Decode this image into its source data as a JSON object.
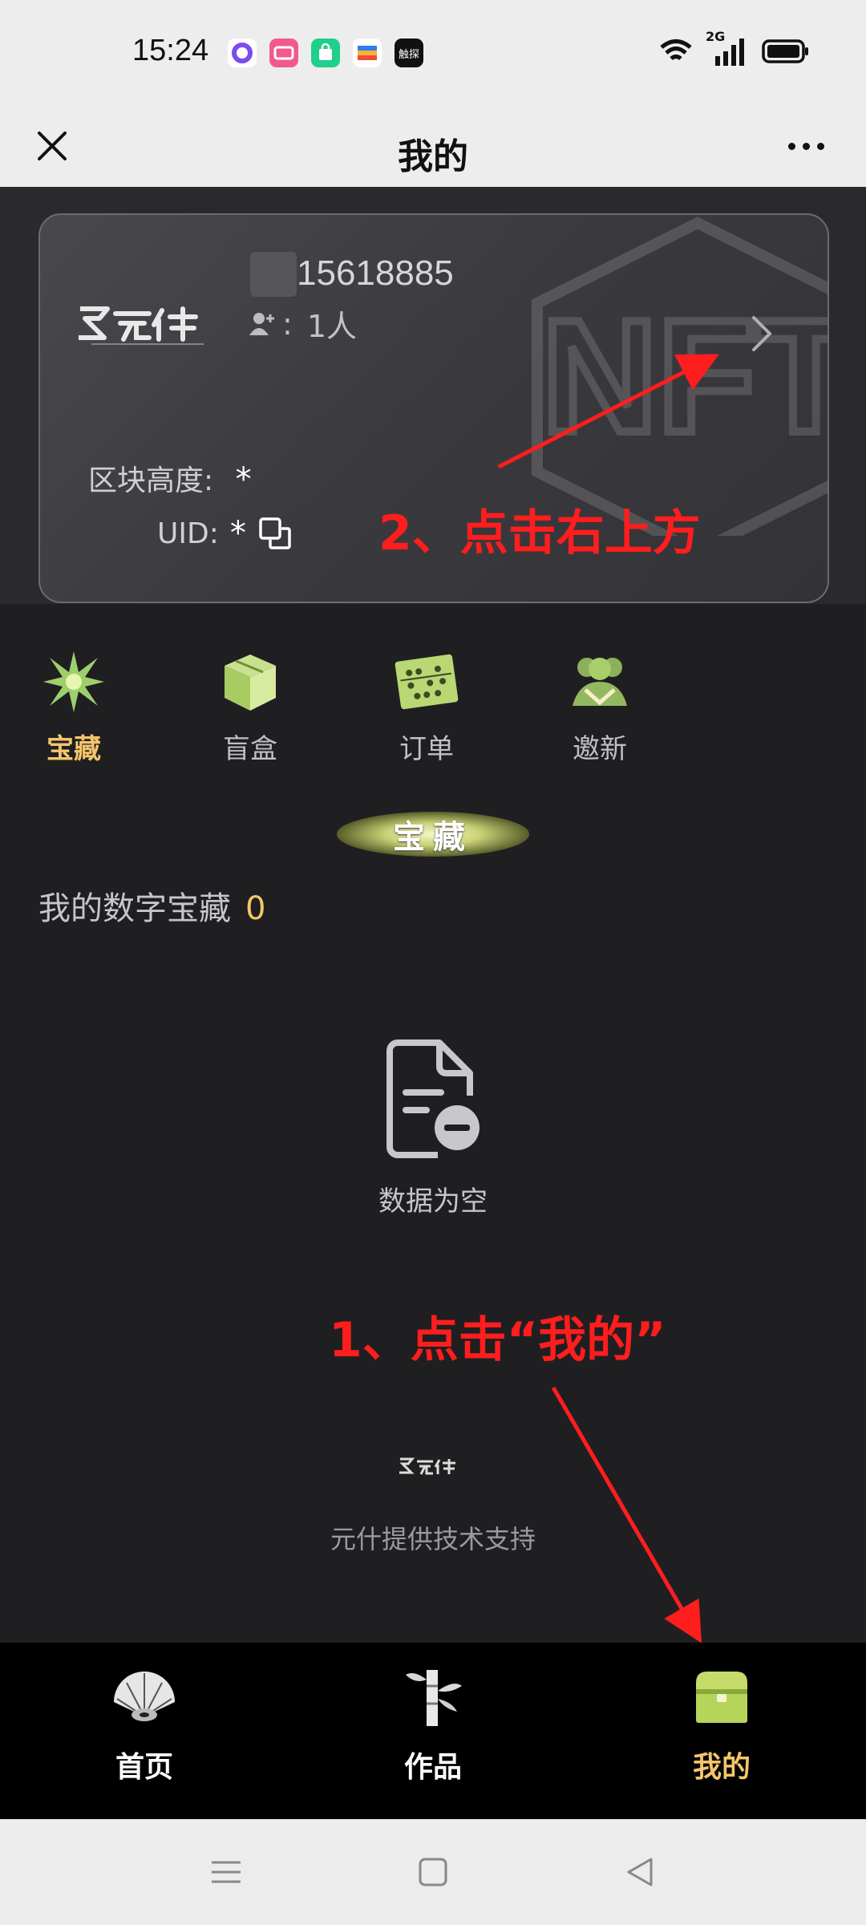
{
  "status_bar": {
    "time": "15:24",
    "notification_icons": [
      "circle-app-icon",
      "pink-app-icon",
      "green-shop-icon",
      "wallet-icon",
      "black-app-icon"
    ],
    "black_app_label": "触探",
    "network": "2G",
    "icons": [
      "wifi-icon",
      "signal-icon",
      "battery-icon"
    ]
  },
  "header": {
    "title": "我的",
    "close_icon": "close-icon",
    "more_icon": "more-icon"
  },
  "card": {
    "phone": "15618885",
    "fans_label": ":",
    "fans_count": "1人",
    "block_height_label": "区块高度:",
    "block_height_value": "*",
    "uid_label": "UID:",
    "uid_value": "*",
    "watermark": "NFT"
  },
  "features": [
    {
      "label": "宝藏",
      "icon": "star-burst-icon",
      "active": true
    },
    {
      "label": "盲盒",
      "icon": "blind-box-icon",
      "active": false
    },
    {
      "label": "订单",
      "icon": "abacus-icon",
      "active": false
    },
    {
      "label": "邀新",
      "icon": "invite-people-icon",
      "active": false
    }
  ],
  "section_title": "宝藏",
  "collection": {
    "label": "我的数字宝藏",
    "count": "0"
  },
  "empty_state": {
    "text": "数据为空",
    "icon": "empty-document-icon"
  },
  "footer": {
    "support_text": "元什提供技术支持"
  },
  "annotations": {
    "step2": "2、点击右上方",
    "step1": "1、点击“我的”",
    "color": "#ff1d1d"
  },
  "bottom_nav": [
    {
      "label": "首页",
      "icon": "fan-icon",
      "active": false
    },
    {
      "label": "作品",
      "icon": "bamboo-icon",
      "active": false
    },
    {
      "label": "我的",
      "icon": "treasure-box-icon",
      "active": true
    }
  ],
  "colors": {
    "accent": "#f4c56a",
    "background": "#1f1f22",
    "nav_background": "#000000"
  }
}
